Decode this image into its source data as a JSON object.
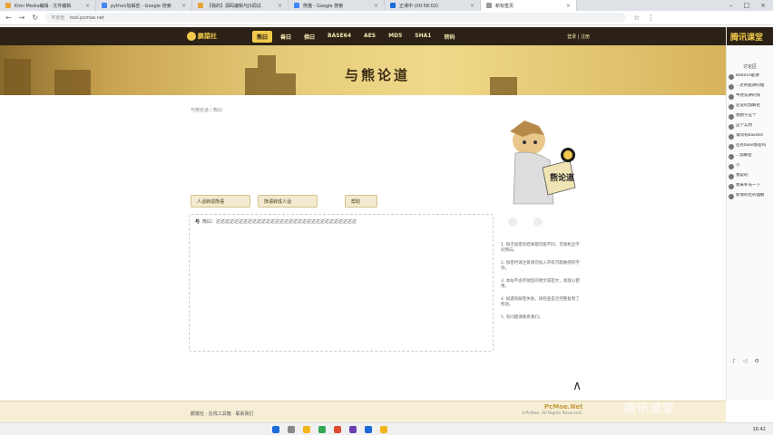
{
  "browser": {
    "tabs": [
      {
        "title": "Kimi Media编辑 · 文件编辑"
      },
      {
        "title": "python加解密 - Google 搜索"
      },
      {
        "title": "【我的】源码编辑与JS调试"
      },
      {
        "title": "熊猫 - Google 搜索"
      },
      {
        "title": "正课中 (00:58:02)"
      },
      {
        "title": "新标签页"
      }
    ],
    "active_tab_index": 5,
    "url_security": "不安全",
    "url": "tool.pcmoe.net"
  },
  "site": {
    "logo_text": "鹏猿社",
    "nav": [
      "熊曰",
      "兽曰",
      "佛曰",
      "BASE64",
      "AES",
      "MD5",
      "SHA1",
      "转码"
    ],
    "active_nav": 0,
    "login": "登录 | 注册",
    "banner_title": "与熊论道"
  },
  "right_panel": {
    "header": "腾讯课堂",
    "subtitle": "讨论区",
    "items": [
      "8a0e1e能讲",
      "...老师能讲的慢",
      "中述说讲的快",
      "还说的加解密",
      "我想学这个",
      "这个实用",
      "请问有base64",
      "还有base加密吗",
      "...加解密",
      "小",
      "我说的",
      "我来补充一下",
      "新增的社的理解"
    ]
  },
  "main": {
    "breadcrumb": "与熊论道 / 熊曰",
    "buttons": {
      "encode": "人话转成熊语",
      "decode": "熊语转成人话",
      "help": "帮助"
    },
    "input_cursor": "与",
    "input_text": "熊曰：达达达达达达达达达达达达达达达达达达达达达达达达达达达达达达达",
    "tips": [
      "1. 每次加密的结果都可能不同，可随机出不同熊曰。",
      "2. 加密时请注意请勿加入带有可能敏感的字符。",
      "3. 本站不会存储您的明文或密文，请放心使用。",
      "4. 如遇到解密失败，请检查是否完整复制了熊语。",
      "5. 有问题请联系我们。"
    ],
    "up_arrow": "∧"
  },
  "footer": {
    "links": "鹏猿社 · 在线工具箱 · 联系我们",
    "brand": "PcMoe.Net",
    "copyright": "©PcMoe. All Rights Reserved."
  },
  "watermark": "腾讯课堂",
  "taskbar": {
    "tray": "16:42"
  }
}
